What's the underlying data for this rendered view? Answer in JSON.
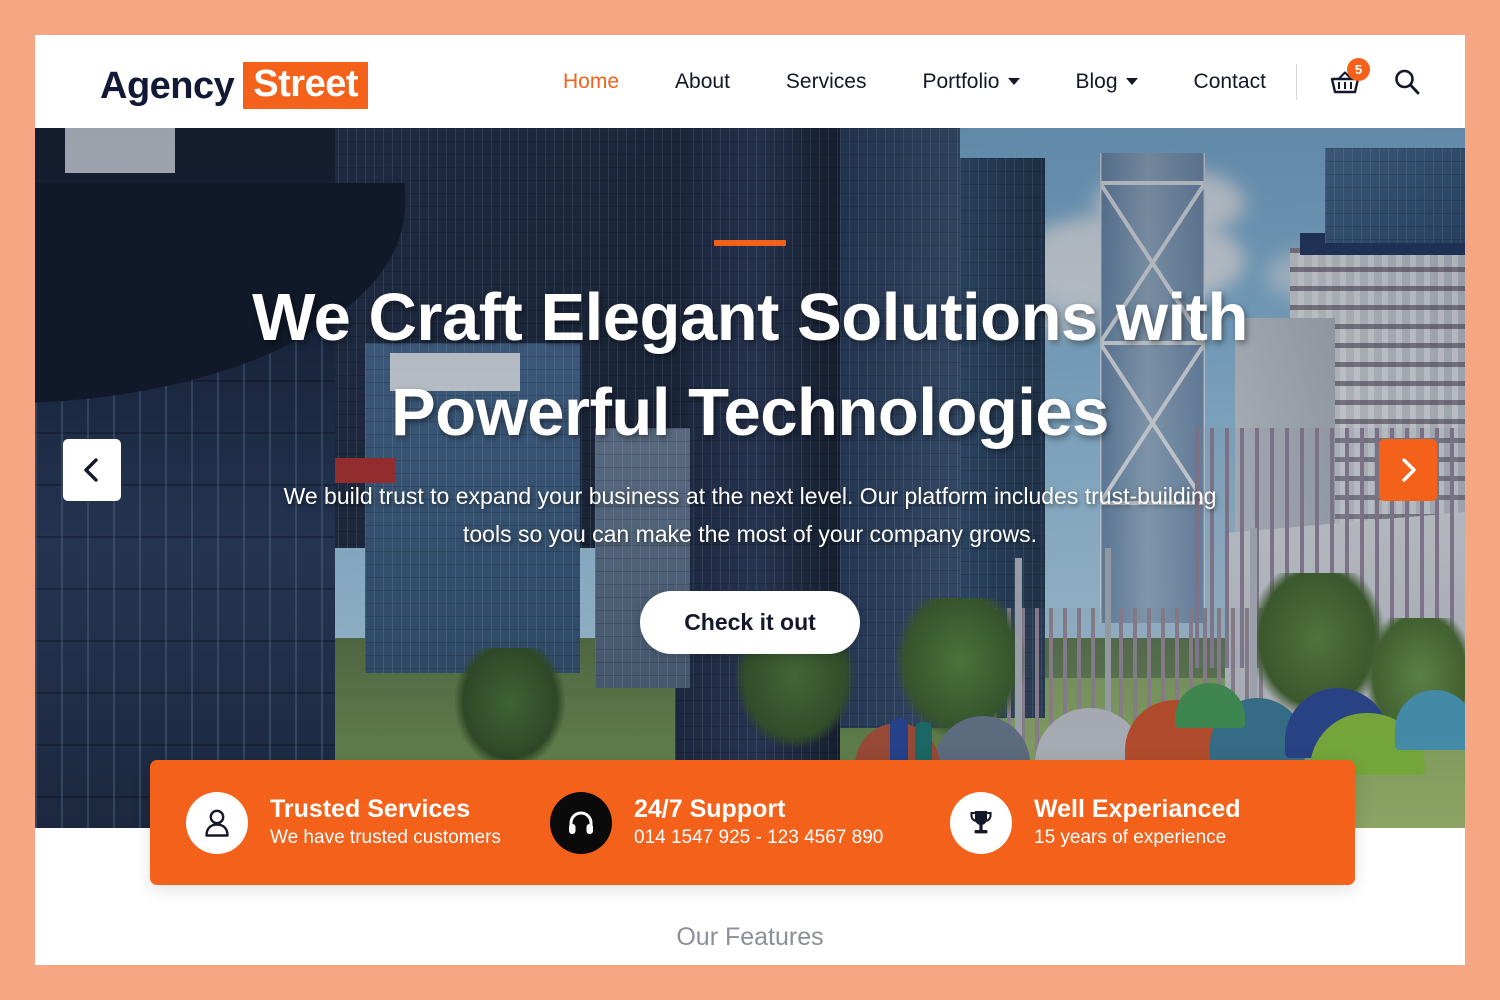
{
  "brand": {
    "name_main": "Agency",
    "name_accent": "Street"
  },
  "nav": {
    "items": [
      {
        "label": "Home",
        "active": true,
        "dropdown": false
      },
      {
        "label": "About",
        "active": false,
        "dropdown": false
      },
      {
        "label": "Services",
        "active": false,
        "dropdown": false
      },
      {
        "label": "Portfolio",
        "active": false,
        "dropdown": true
      },
      {
        "label": "Blog",
        "active": false,
        "dropdown": true
      },
      {
        "label": "Contact",
        "active": false,
        "dropdown": false
      }
    ],
    "cart_icon": "shopping-basket-icon",
    "cart_count": "5",
    "search_icon": "search-icon"
  },
  "hero": {
    "title": "We Craft Elegant Solutions with Powerful Technologies",
    "subtitle": "We build trust to expand your business at the next level. Our platform includes trust-building tools so you can make the most of your company grows.",
    "cta_label": "Check it out",
    "prev_icon": "chevron-left-icon",
    "next_icon": "chevron-right-icon"
  },
  "features_bar": [
    {
      "icon": "user-icon",
      "title": "Trusted Services",
      "text": "We have trusted customers"
    },
    {
      "icon": "headset-icon",
      "title": "24/7 Support",
      "text": "014 1547 925 - 123 4567 890"
    },
    {
      "icon": "trophy-icon",
      "title": "Well Experianced",
      "text": "15 years of experience"
    }
  ],
  "features_section": {
    "label": "Our Features"
  },
  "colors": {
    "accent": "#f4611b",
    "page_bg": "#f7a684",
    "logo_dark": "#121836",
    "muted_text": "#8c8e99"
  }
}
